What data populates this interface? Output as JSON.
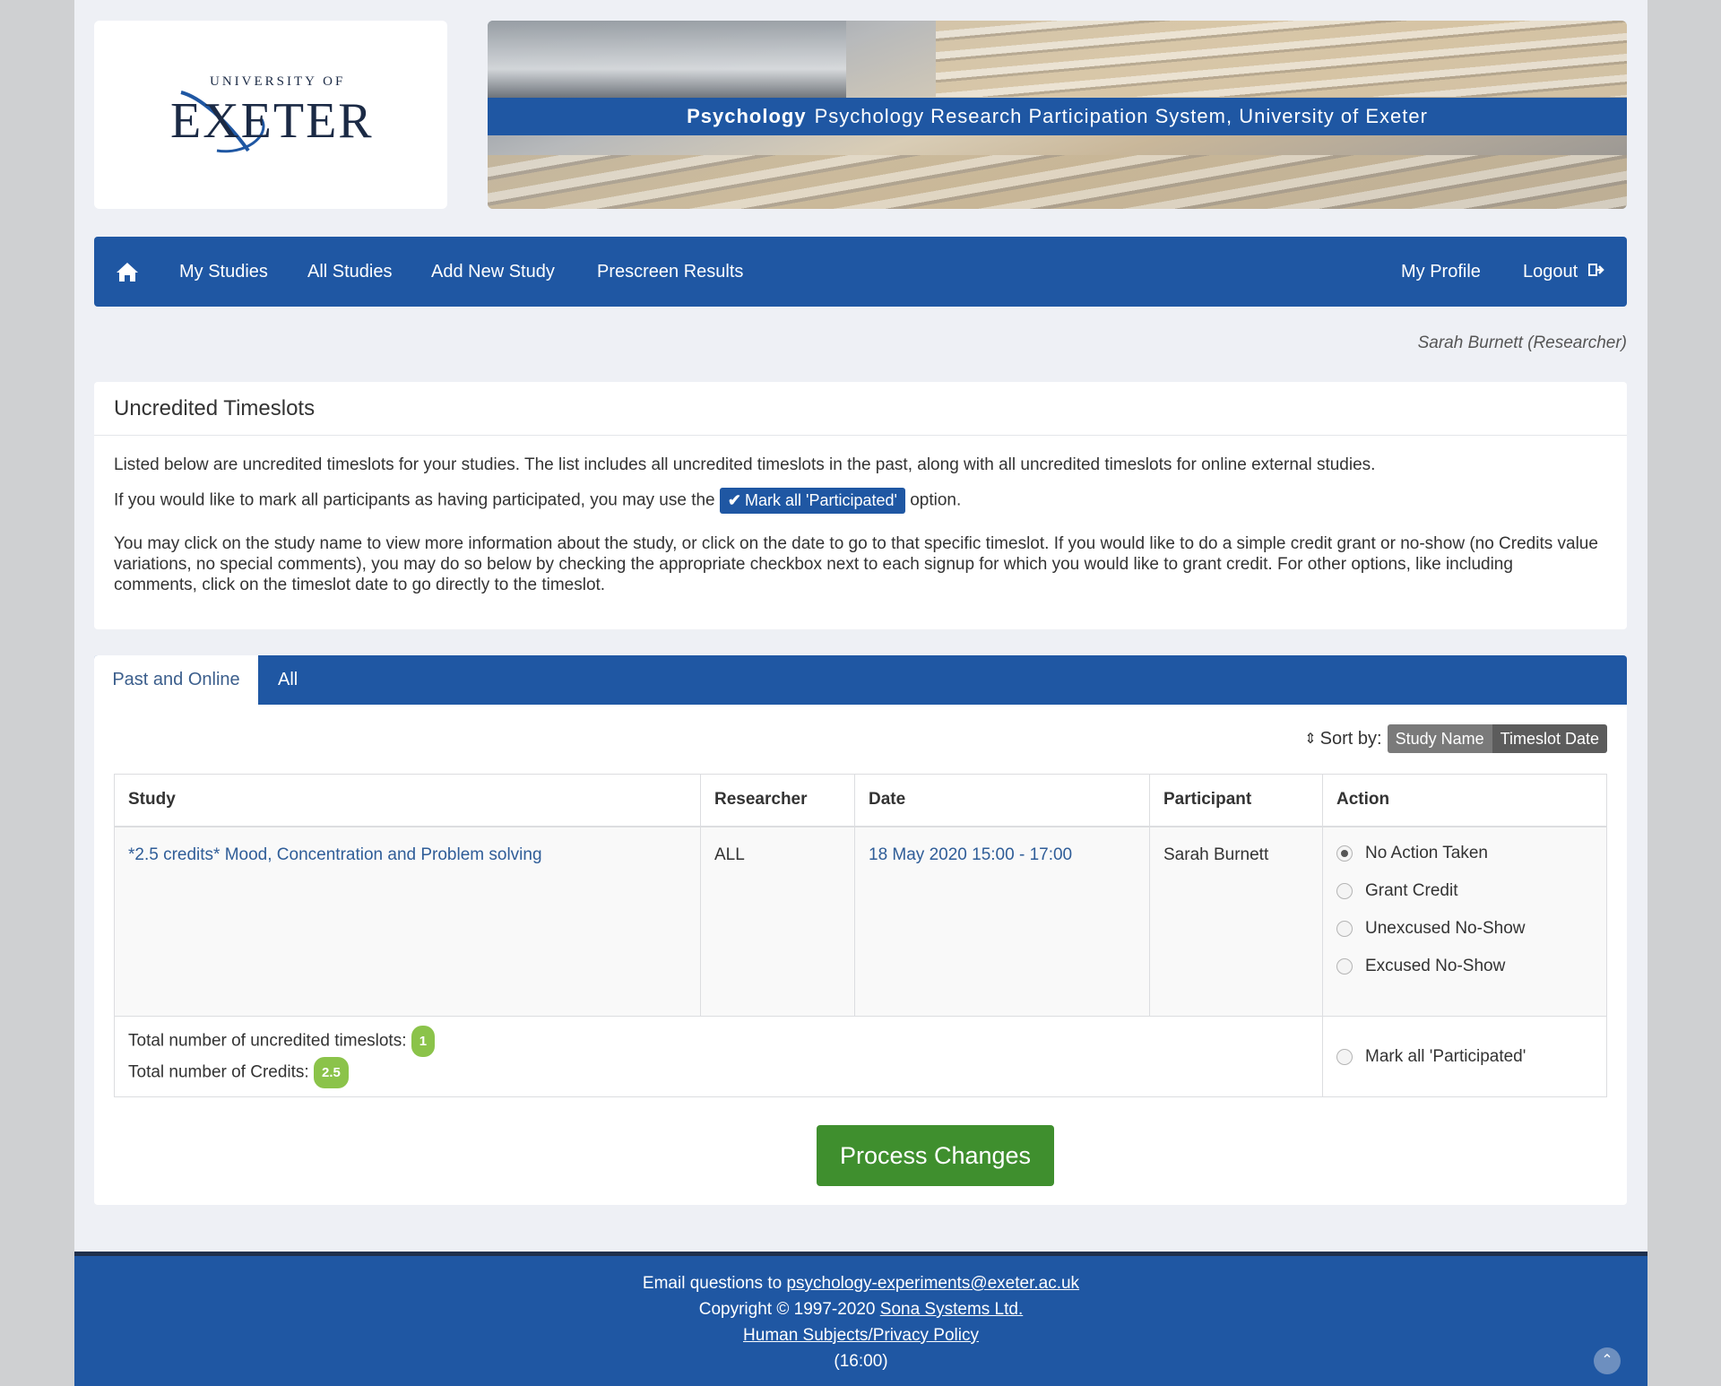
{
  "header": {
    "logo_top": "UNIVERSITY OF",
    "logo_main": "EXETER",
    "banner_bold": "Psychology",
    "banner_title": "Psychology Research Participation System, University of Exeter"
  },
  "nav": {
    "items": [
      "My Studies",
      "All Studies",
      "Add New Study",
      "Prescreen Results"
    ],
    "profile": "My Profile",
    "logout": "Logout"
  },
  "user": "Sarah Burnett (Researcher)",
  "panel": {
    "heading": "Uncredited Timeslots",
    "para1": "Listed below are uncredited timeslots for your studies. The list includes all uncredited timeslots in the past, along with all uncredited timeslots for online external studies.",
    "para2_before": "If you would like to mark all participants as having participated, you may use the",
    "mark_button": "Mark all 'Participated'",
    "para2_after": "option.",
    "para3": "You may click on the study name to view more information about the study, or click on the date to go to that specific timeslot. If you would like to do a simple credit grant or no-show (no Credits value variations, no special comments), you may do so below by checking the appropriate checkbox next to each signup for which you would like to grant credit. For other options, like including comments, click on the timeslot date to go directly to the timeslot."
  },
  "tabs": [
    "Past and Online",
    "All"
  ],
  "sort": {
    "label": "Sort by:",
    "options": [
      "Study Name",
      "Timeslot Date"
    ]
  },
  "table": {
    "headers": [
      "Study",
      "Researcher",
      "Date",
      "Participant",
      "Action"
    ],
    "row": {
      "study": "*2.5 credits* Mood, Concentration and Problem solving",
      "researcher": "ALL",
      "date": "18 May 2020 15:00 - 17:00",
      "participant": "Sarah Burnett",
      "actions": [
        "No Action Taken",
        "Grant Credit",
        "Unexcused No-Show",
        "Excused No-Show"
      ],
      "selected_action": "No Action Taken"
    },
    "totals": {
      "timeslots_label": "Total number of uncredited timeslots:",
      "timeslots_value": "1",
      "credits_label": "Total number of Credits:",
      "credits_value": "2.5",
      "mark_all": "Mark all 'Participated'"
    }
  },
  "process_button": "Process Changes",
  "footer": {
    "email_prefix": "Email questions to",
    "email": "psychology-experiments@exeter.ac.uk",
    "copyright_prefix": "Copyright © 1997-2020",
    "sona": "Sona Systems Ltd.",
    "privacy": "Human Subjects/Privacy Policy",
    "time": "(16:00)"
  },
  "colors": {
    "brand_blue": "#1f57a3",
    "process_green": "#3f8f2e",
    "badge_green": "#8bc34a"
  }
}
